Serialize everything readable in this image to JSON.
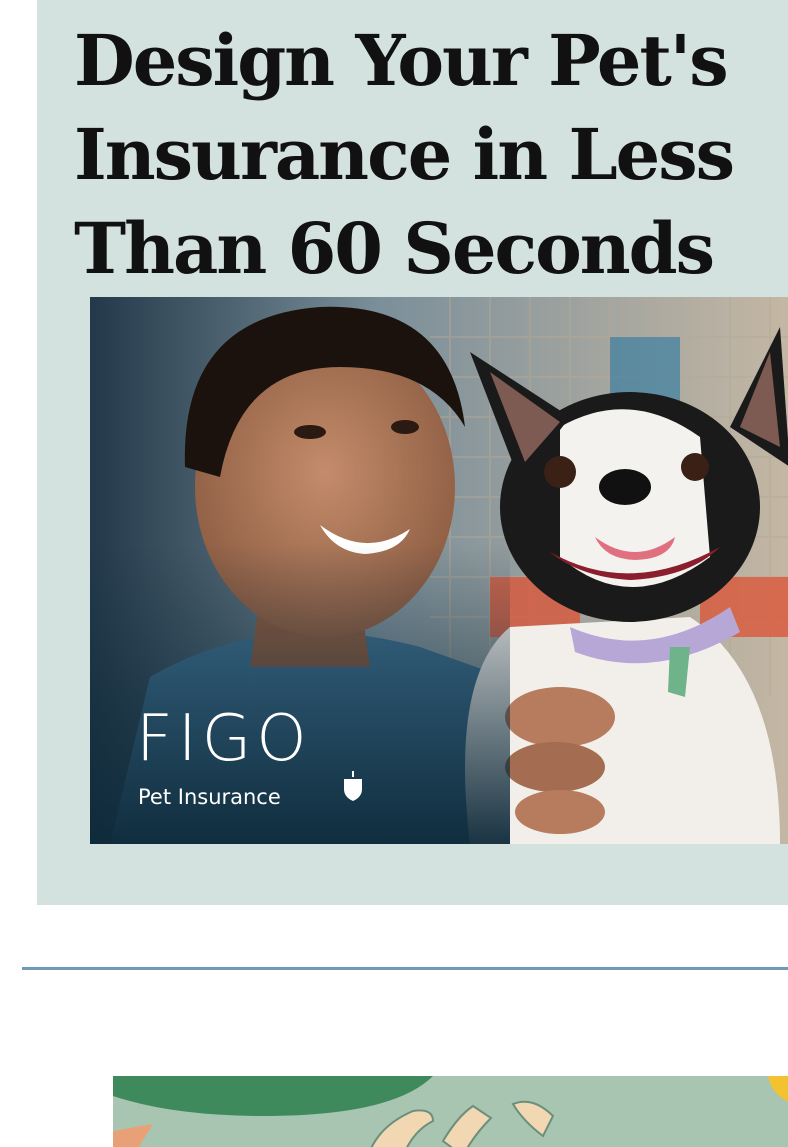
{
  "promo": {
    "headline": "Design Your Pet's Insurance in Less\nThan 60 Seconds",
    "ad": {
      "brand": "FIGO",
      "brand_sub": "Pet Insurance"
    }
  },
  "colors": {
    "card_bg": "#d3e1df",
    "divider": "#6f9bb6",
    "headline": "#111111"
  }
}
